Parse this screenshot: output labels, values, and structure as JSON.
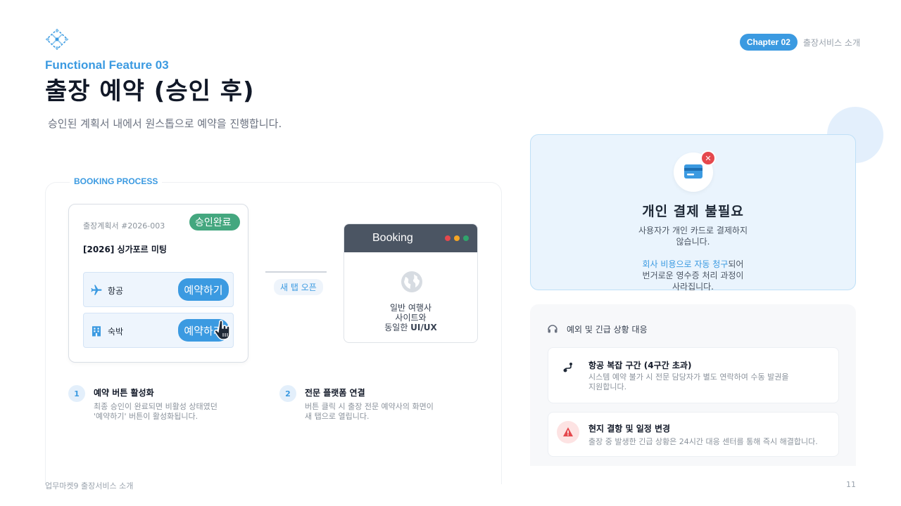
{
  "header": {
    "logo_icon": "diamond-network-icon",
    "chapter_label": "Chapter 02",
    "chapter_title": "출장서비스 소개",
    "feature_label": "Functional Feature 03",
    "title": "출장 예약 (승인 후)",
    "subtitle": "승인된 계획서 내에서 원스톱으로 예약을 진행합니다."
  },
  "process": {
    "section_label": "BOOKING PROCESS",
    "plan_card": {
      "plan_id": "출장계획서 #2026-003",
      "badge": "승인완료",
      "name": "[2026] 싱가포르 미팅",
      "rows": [
        {
          "icon": "airplane-icon",
          "label": "항공",
          "button": "예약하기"
        },
        {
          "icon": "hotel-icon",
          "label": "숙박",
          "button": "예약하기"
        }
      ]
    },
    "connector_label": "새 탭 오픈",
    "browser": {
      "title": "Booking",
      "dot_colors": [
        "#e5484d",
        "#f5a524",
        "#30a46c"
      ],
      "text_line1": "일반 여행사",
      "text_line2": "사이트와",
      "text_line3_prefix": "동일한 ",
      "text_line3_bold": "UI/UX"
    },
    "steps": [
      {
        "num": "1",
        "title": "예약 버튼 활성화",
        "desc_line1": "최종 승인이 완료되면 비활성 상태였던",
        "desc_line2": "'예약하기' 버튼이 활성화됩니다."
      },
      {
        "num": "2",
        "title": "전문 플랫폼 연결",
        "desc_line1": "버튼 클릭 시 출장 전문 예약사의 화면이",
        "desc_line2": "새 탭으로 열립니다."
      }
    ]
  },
  "payment": {
    "icon": "credit-card-icon",
    "title": "개인 결제 불필요",
    "desc_line1": "사용자가 개인 카드로 결제하지",
    "desc_line2": "않습니다.",
    "highlight": "회사 비용으로 자동 청구",
    "desc_line3_suffix": "되어",
    "desc_line4": "번거로운 영수증 처리 과정이",
    "desc_line5": "사라집니다."
  },
  "exceptions": {
    "header_icon": "headset-icon",
    "header": "예외 및 긴급 상황 대응",
    "items": [
      {
        "icon": "route-icon",
        "title": "항공 복잡 구간 (4구간 초과)",
        "desc_line1": "시스템 예약 불가 시 전문 담당자가 별도 연락하여 수동 발권을",
        "desc_line2": "지원합니다."
      },
      {
        "icon": "warning-icon",
        "title": "현지 결항 및 일정 변경",
        "desc_line1": "출장 중 발생한 긴급 상황은 24시간 대응 센터를 통해 즉시 해결합니다."
      }
    ]
  },
  "footer": {
    "left": "업무마켓9 출장서비스 소개",
    "page": "11"
  },
  "colors": {
    "accent": "#3b9ae1",
    "success": "#44a77f",
    "danger": "#e5484d"
  }
}
